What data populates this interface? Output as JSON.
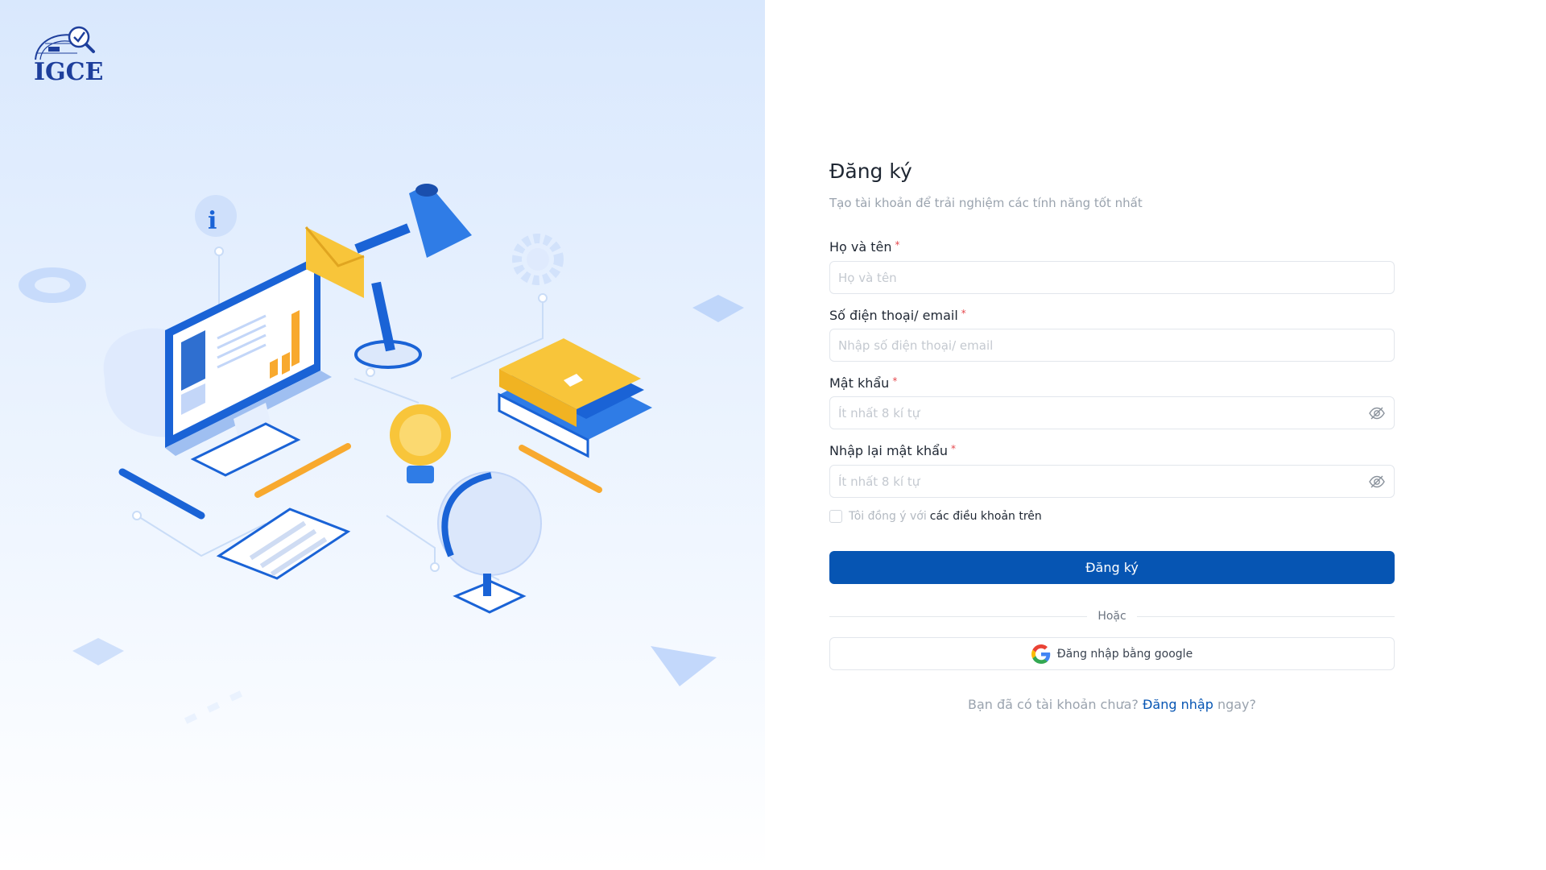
{
  "brand": {
    "logo_text": "IGCE"
  },
  "form": {
    "title": "Đăng ký",
    "subtitle": "Tạo tài khoản để trải nghiệm các tính năng tốt nhất",
    "fields": [
      {
        "label": "Họ và tên",
        "required": "*",
        "placeholder": "Họ và tên",
        "value": ""
      },
      {
        "label": "Số điện thoại/ email",
        "required": "*",
        "placeholder": "Nhập số điện thoại/ email",
        "value": ""
      },
      {
        "label": "Mật khẩu",
        "required": "*",
        "placeholder": "Ít nhất 8 kí tự",
        "value": "",
        "icon": "eye-off-icon"
      },
      {
        "label": "Nhập lại mật khẩu",
        "required": "*",
        "placeholder": "Ít nhất 8 kí tự",
        "value": "",
        "icon": "eye-off-icon"
      }
    ],
    "agree_text": "Tôi đồng ý với",
    "agree_link": "các điều khoản trên",
    "submit_label": "Đăng ký",
    "divider_text": "Hoặc",
    "google_label": "Đăng nhập bằng google",
    "footer": {
      "prefix": "Bạn đã có tài khoản chưa?",
      "link": "Đăng nhập",
      "suffix": "ngay?"
    }
  },
  "colors": {
    "primary": "#0655b3",
    "required": "#e5484d",
    "hero_bg": "#dce9fd",
    "illustration_blue": "#1a63d6",
    "illustration_yellow": "#f8c53a"
  }
}
